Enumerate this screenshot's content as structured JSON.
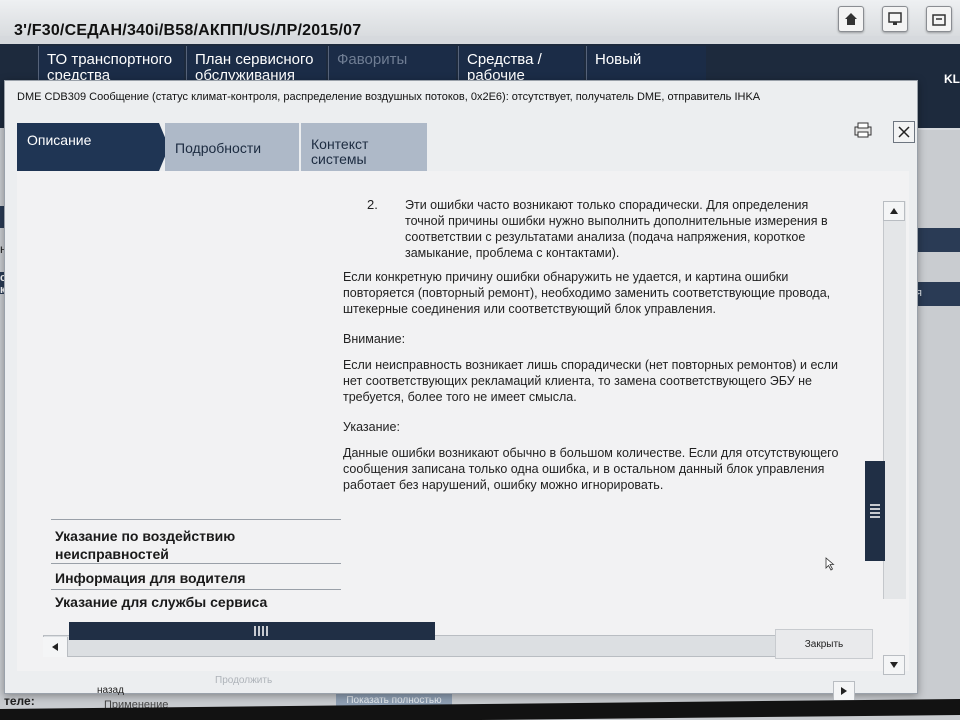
{
  "app": {
    "vehicle_path": "3'/F30/СЕДАН/340i/B58/АКПП/US/ЛР/2015/07",
    "nav_tabs": [
      {
        "label": "ТО транспортного средства",
        "dim": false
      },
      {
        "label": "План сервисного обслуживания",
        "dim": false
      },
      {
        "label": "Фавориты",
        "dim": true
      },
      {
        "label": "Средства / рабочие жидкости",
        "dim": false
      },
      {
        "label": "Новый",
        "dim": false
      }
    ],
    "nav_right": "KL",
    "left_fragments": [
      "не",
      "с к"
    ],
    "right_fragment": "я",
    "bottom_label": "теле:",
    "bottom_hidden": "Применение\nфильтра для",
    "show_full_label": "Показать полностью"
  },
  "dialog": {
    "title": "DME CDB309 Сообщение (статус климат-контроля, распределение воздушных потоков, 0x2E6): отсутствует, получатель DME, отправитель IHKA",
    "tabs": [
      {
        "label": "Описание",
        "active": true
      },
      {
        "label": "Подробности",
        "active": false
      },
      {
        "label": "Контекст системы",
        "active": false
      }
    ],
    "left_items": [
      "Указание по воздействию неисправностей",
      "Информация для водителя",
      "Указание для службы сервиса"
    ],
    "list_number": "2.",
    "list_text": "Эти ошибки часто возникают только спорадически. Для определения точной причины ошибки нужно выполнить дополнительные измерения в соответствии с результатами анализа (подача напряжения, короткое замыкание, проблема с контактами).",
    "para1": "Если конкретную причину ошибки обнаружить не удается, и картина ошибки повторяется (повторный ремонт), необходимо заменить соответствующие провода, штекерные соединения или соответствующий блок управления.",
    "heading1": "Внимание:",
    "para2": "Если неисправность возникает лишь спорадически (нет повторных ремонтов) и если нет соответствующих рекламаций клиента, то замена соответствующего ЭБУ не требуется, более того не имеет смысла.",
    "heading2": "Указание:",
    "para3": "Данные ошибки возникают обычно в большом количестве. Если для отсутствующего сообщения записана только одна ошибка, и в остальном данный блок управления работает без нарушений, ошибку можно игнорировать.",
    "close_label": "Закрыть",
    "back_label": "назад",
    "next_label": "Продолжить"
  }
}
